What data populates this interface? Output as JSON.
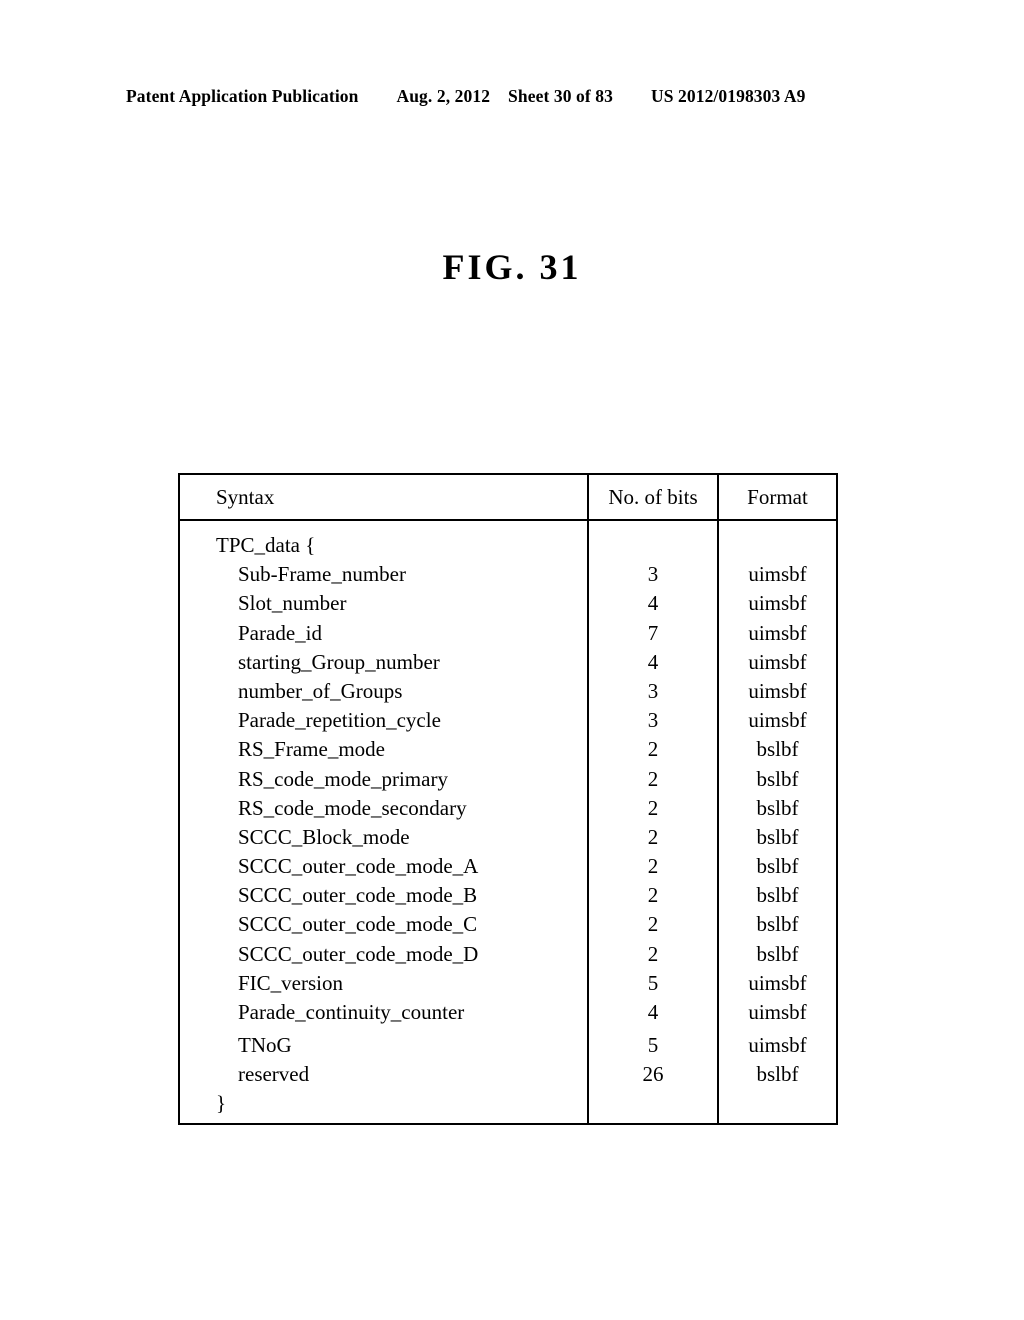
{
  "header": {
    "publication": "Patent Application Publication",
    "date": "Aug. 2, 2012",
    "sheet": "Sheet 30 of 83",
    "patent_number": "US 2012/0198303 A9"
  },
  "figure": {
    "title": "FIG. 31"
  },
  "table": {
    "columns": [
      "Syntax",
      "No. of bits",
      "Format"
    ],
    "rows": [
      {
        "syntax": "TPC_data {",
        "indent": 0,
        "bits": "",
        "format": ""
      },
      {
        "syntax": "Sub-Frame_number",
        "indent": 1,
        "bits": "3",
        "format": "uimsbf"
      },
      {
        "syntax": "Slot_number",
        "indent": 1,
        "bits": "4",
        "format": "uimsbf"
      },
      {
        "syntax": "Parade_id",
        "indent": 1,
        "bits": "7",
        "format": "uimsbf"
      },
      {
        "syntax": "starting_Group_number",
        "indent": 1,
        "bits": "4",
        "format": "uimsbf"
      },
      {
        "syntax": "number_of_Groups",
        "indent": 1,
        "bits": "3",
        "format": "uimsbf"
      },
      {
        "syntax": "Parade_repetition_cycle",
        "indent": 1,
        "bits": "3",
        "format": "uimsbf"
      },
      {
        "syntax": "RS_Frame_mode",
        "indent": 1,
        "bits": "2",
        "format": "bslbf"
      },
      {
        "syntax": "RS_code_mode_primary",
        "indent": 1,
        "bits": "2",
        "format": "bslbf"
      },
      {
        "syntax": "RS_code_mode_secondary",
        "indent": 1,
        "bits": "2",
        "format": "bslbf"
      },
      {
        "syntax": "SCCC_Block_mode",
        "indent": 1,
        "bits": "2",
        "format": "bslbf"
      },
      {
        "syntax": "SCCC_outer_code_mode_A",
        "indent": 1,
        "bits": "2",
        "format": "bslbf"
      },
      {
        "syntax": "SCCC_outer_code_mode_B",
        "indent": 1,
        "bits": "2",
        "format": "bslbf"
      },
      {
        "syntax": "SCCC_outer_code_mode_C",
        "indent": 1,
        "bits": "2",
        "format": "bslbf"
      },
      {
        "syntax": "SCCC_outer_code_mode_D",
        "indent": 1,
        "bits": "2",
        "format": "bslbf"
      },
      {
        "syntax": "FIC_version",
        "indent": 1,
        "bits": "5",
        "format": "uimsbf"
      },
      {
        "syntax": "Parade_continuity_counter",
        "indent": 1,
        "bits": "4",
        "format": "uimsbf"
      },
      {
        "syntax": "TNoG",
        "indent": 1,
        "bits": "5",
        "format": "uimsbf",
        "extra_lead": true
      },
      {
        "syntax": "reserved",
        "indent": 1,
        "bits": "26",
        "format": "bslbf"
      },
      {
        "syntax": "}",
        "indent": 0,
        "bits": "",
        "format": ""
      }
    ]
  }
}
